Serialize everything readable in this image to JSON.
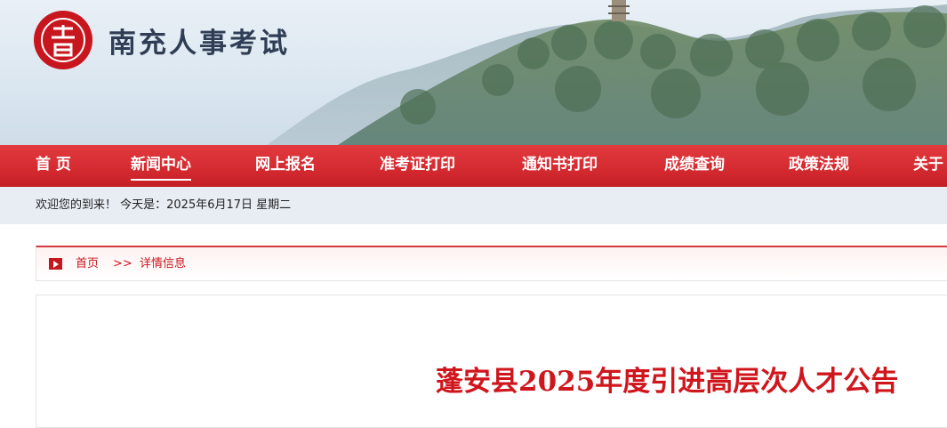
{
  "header": {
    "site_name": "南充人事考试",
    "logo_icon": "seal-logo-icon"
  },
  "nav": {
    "items": [
      {
        "label": "首 页"
      },
      {
        "label": "新闻中心",
        "active": true
      },
      {
        "label": "网上报名"
      },
      {
        "label": "准考证打印"
      },
      {
        "label": "通知书打印"
      },
      {
        "label": "成绩查询"
      },
      {
        "label": "政策法规"
      },
      {
        "label": "关于"
      }
    ]
  },
  "welcome": {
    "text": "欢迎您的到来！ 今天是：2025年6月17日 星期二"
  },
  "breadcrumb": {
    "home": "首页",
    "separator": ">>",
    "current": "详情信息"
  },
  "article": {
    "title": "蓬安县2025年度引进高层次人才公告"
  },
  "colors": {
    "brand_red": "#c8161e",
    "nav_red": "#d32a30",
    "title_red": "#d0161d",
    "site_name": "#2f3e55"
  }
}
